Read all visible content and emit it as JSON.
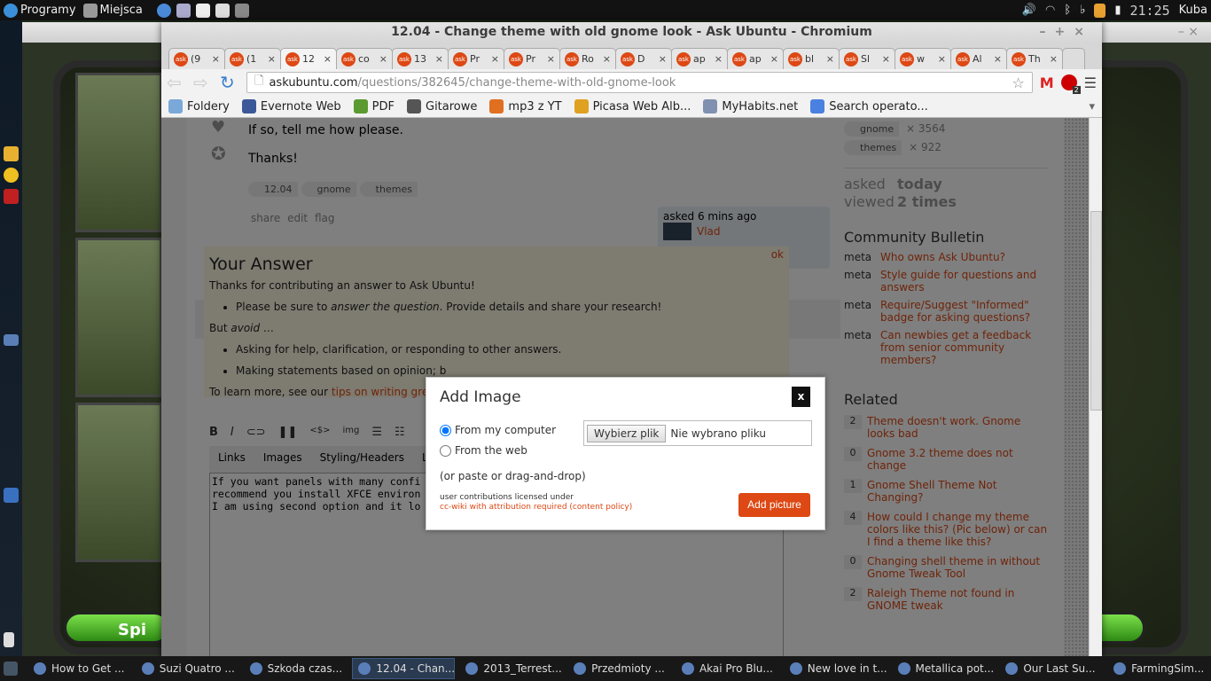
{
  "top_panel": {
    "apps_label": "Programy",
    "places_label": "Miejsca",
    "clock": "21:25",
    "user": "Kuba"
  },
  "window": {
    "title": "12.04 - Change theme with old gnome look - Ask Ubuntu - Chromium"
  },
  "tabs": [
    {
      "label": "(9"
    },
    {
      "label": "(1"
    },
    {
      "label": "12"
    },
    {
      "label": "co"
    },
    {
      "label": "13"
    },
    {
      "label": "Pr"
    },
    {
      "label": "Pr"
    },
    {
      "label": "Ro"
    },
    {
      "label": "D"
    },
    {
      "label": "ap"
    },
    {
      "label": "ap"
    },
    {
      "label": "bl"
    },
    {
      "label": "Sl"
    },
    {
      "label": "w"
    },
    {
      "label": "Al"
    },
    {
      "label": "Th"
    }
  ],
  "omnibox": {
    "domain": "askubuntu.com",
    "path": "/questions/382645/change-theme-with-old-gnome-look",
    "badge": "2"
  },
  "bookmarks": [
    "Foldery",
    "Evernote Web",
    "PDF",
    "Gitarowe",
    "mp3 z YT",
    "Picasa Web Alb...",
    "MyHabits.net",
    "Search operato..."
  ],
  "question": {
    "line1": "If so, tell me how please.",
    "line2": "Thanks!",
    "tags": [
      "12.04",
      "gnome",
      "themes"
    ],
    "actions": [
      "share",
      "edit",
      "flag"
    ],
    "asked": "asked 6 mins ago",
    "user": "Vlad"
  },
  "answer": {
    "title": "Your Answer",
    "ok": "ok",
    "intro": "Thanks for contributing an answer to Ask Ubuntu!",
    "b1a": "Please be sure to ",
    "b1b": "answer the question",
    "b1c": ". Provide details and share your research!",
    "but": "But ",
    "avoid": "avoid",
    "ell": " …",
    "b2": "Asking for help, clarification, or responding to other answers.",
    "b3": "Making statements based on opinion; b",
    "learn": "To learn more, see our ",
    "tips": "tips on writing great a"
  },
  "editor": {
    "toolbar": [
      "B",
      "I",
      "<$>",
      "img"
    ],
    "help_tabs": [
      "Links",
      "Images",
      "Styling/Headers",
      "Lists"
    ],
    "lines": [
      "If you want panels with many confi",
      "recommend you install XFCE environ",
      "I am using second option and it lo"
    ]
  },
  "sidebar": {
    "tag_stats": [
      {
        "tag": "gnome",
        "count": "× 3564"
      },
      {
        "tag": "themes",
        "count": "× 922"
      }
    ],
    "asked_label": "asked",
    "asked_value": "today",
    "viewed_label": "viewed",
    "viewed_value": "2 times",
    "bulletin_title": "Community Bulletin",
    "bulletin": [
      {
        "tag": "meta",
        "text": "Who owns Ask Ubuntu?"
      },
      {
        "tag": "meta",
        "text": "Style guide for questions and answers"
      },
      {
        "tag": "meta",
        "text": "Require/Suggest \"Informed\" badge for asking questions?"
      },
      {
        "tag": "meta",
        "text": "Can newbies get a feedback from senior community members?"
      }
    ],
    "related_title": "Related",
    "related": [
      {
        "n": "2",
        "text": "Theme doesn't work. Gnome looks bad"
      },
      {
        "n": "0",
        "text": "Gnome 3.2 theme does not change"
      },
      {
        "n": "1",
        "text": "Gnome Shell Theme Not Changing?"
      },
      {
        "n": "4",
        "text": "How could I change my theme colors like this? (Pic below) or can I find a theme like this?"
      },
      {
        "n": "0",
        "text": "Changing shell theme in without Gnome Tweak Tool"
      },
      {
        "n": "2",
        "text": "Raleigh Theme not found in GNOME tweak"
      }
    ]
  },
  "dialog": {
    "title": "Add Image",
    "close": "x",
    "opt1": "From my computer",
    "opt2": "From the web",
    "choose": "Wybierz plik",
    "nofile": "Nie wybrano pliku",
    "paste": "(or paste or drag-and-drop)",
    "license1": "user contributions licensed under",
    "license2": "cc-wiki with attribution required (content policy)",
    "submit": "Add picture"
  },
  "game": {
    "button": "Spi"
  },
  "taskbar": [
    {
      "label": "How to Get ..."
    },
    {
      "label": "Suzi Quatro ..."
    },
    {
      "label": "Szkoda czas..."
    },
    {
      "label": "12.04 - Chan...",
      "active": true
    },
    {
      "label": "2013_Terrest..."
    },
    {
      "label": "Przedmioty ..."
    },
    {
      "label": "Akai Pro Blu..."
    },
    {
      "label": "New love in t..."
    },
    {
      "label": "Metallica pot..."
    },
    {
      "label": "Our Last Su..."
    },
    {
      "label": "FarmingSim..."
    }
  ],
  "colors": {
    "accent": "#dd4814",
    "panel": "#121212"
  }
}
